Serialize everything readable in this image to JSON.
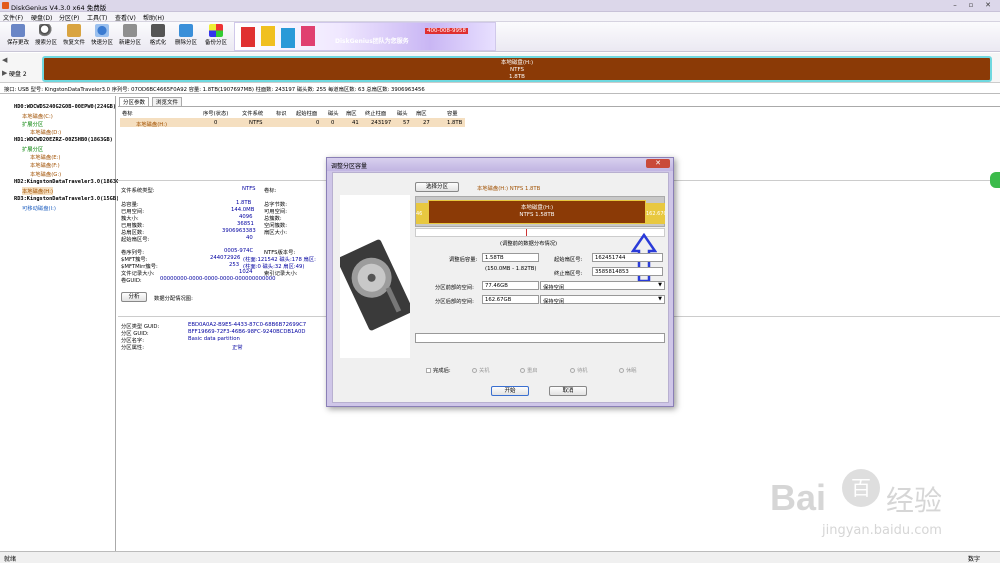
{
  "title": "DiskGenius V4.3.0 x64 免费版",
  "menu": [
    "文件(F)",
    "硬盘(D)",
    "分区(P)",
    "工具(T)",
    "查看(V)",
    "帮助(H)"
  ],
  "toolbar": [
    "保存更改",
    "搜索分区",
    "恢复文件",
    "快速分区",
    "新建分区",
    "格式化",
    "删除分区",
    "备份分区"
  ],
  "banner": {
    "text": "DiskGenius团队为您服务",
    "phone": "400-008-9958"
  },
  "disk_label": "硬盘 2",
  "disk_bar": {
    "name": "本地磁盘(H:)",
    "fs": "NTFS",
    "size": "1.8TB"
  },
  "info": "接口: USB  型号: KingstonDataTraveler3.0  序列号: 07OD6BC4665F0A92  容量: 1.8TB(1907697MB)  柱面数: 243197  磁头数: 255  每道扇区数: 63  总扇区数: 3906963456",
  "tree": [
    {
      "t": "HD0:WDCWDS240G2G0B-00EPW0(224GB)",
      "kind": "hd"
    },
    {
      "t": "本地磁盘(C:)",
      "kind": "p"
    },
    {
      "t": "扩展分区",
      "kind": "ext"
    },
    {
      "t": "本地磁盘(D:)",
      "kind": "p"
    },
    {
      "t": "HD1:WDCWD20EZRZ-00Z5HB0(1863GB)",
      "kind": "hd"
    },
    {
      "t": "扩展分区",
      "kind": "ext"
    },
    {
      "t": "本地磁盘(E:)",
      "kind": "p"
    },
    {
      "t": "本地磁盘(F:)",
      "kind": "p"
    },
    {
      "t": "本地磁盘(G:)",
      "kind": "p"
    },
    {
      "t": "HD2:KingstonDataTraveler3.0(1863GB)",
      "kind": "hd"
    },
    {
      "t": "本地磁盘(H:)",
      "kind": "sel"
    },
    {
      "t": "RD3:KingstonDataTraveler3.0(15GB)",
      "kind": "hd"
    },
    {
      "t": "可移动磁盘(I:)",
      "kind": "rm"
    }
  ],
  "tabs": [
    "分区参数",
    "浏览文件"
  ],
  "table": {
    "headers": [
      "卷标",
      "序号(状态)",
      "文件系统",
      "标识",
      "起始柱面",
      "磁头",
      "扇区",
      "终止柱面",
      "磁头",
      "扇区",
      "容量"
    ],
    "row": [
      "本地磁盘(H:)",
      "0",
      "NTFS",
      "",
      "0",
      "0",
      "41",
      "243197",
      "57",
      "27",
      "1.8TB"
    ]
  },
  "fs": {
    "type_l": "文件系统类型:",
    "type_v": "NTFS",
    "vol_l": "卷标:",
    "left": [
      [
        "总容量:",
        "1.8TB"
      ],
      [
        "已用空间:",
        "144.0MB"
      ],
      [
        "簇大小:",
        "4096"
      ],
      [
        "已用簇数:",
        "36851"
      ],
      [
        "总扇区数:",
        "3906963383"
      ],
      [
        "起始扇区号:",
        "40"
      ]
    ],
    "right": [
      "总字节数:",
      "可用空间:",
      "总簇数:",
      "空闲簇数:",
      "扇区大小:"
    ],
    "mid": [
      [
        "卷序列号:",
        "0005-974C",
        "NTFS版本号:"
      ],
      [
        "$MFT簇号:",
        "244072926",
        "(柱面:121542 磁头:178 扇区:"
      ],
      [
        "$MFTMirr簇号:",
        "253",
        "(柱面:0 磁头:32 扇区:49)"
      ],
      [
        "文件记录大小:",
        "1024",
        "索引记录大小:"
      ],
      [
        "卷GUID:",
        "00000000-0000-0000-0000-000000000000",
        ""
      ]
    ],
    "analyze_btn": "分析",
    "analyze_l": "数据分配情况图:",
    "guid": [
      [
        "分区类型 GUID:",
        "EBD0A0A2-B9E5-4433-87C0-68B6B72699C7"
      ],
      [
        "分区 GUID:",
        "BFF19669-72F3-46B6-98FC-9240BCDB1A0D"
      ],
      [
        "分区名字:",
        "Basic data partition"
      ],
      [
        "分区属性:",
        "正常"
      ]
    ]
  },
  "dialog": {
    "title": "调整分区容量",
    "close": "✕",
    "select_btn": "选择分区",
    "partinfo": "本地磁盘(H:) NTFS 1.8TB",
    "bar": {
      "name": "本地磁盘(H:)",
      "fs": "NTFS 1.58TB",
      "left": "46",
      "right": "162.67G"
    },
    "caption": "(调整前的数据分布情况)",
    "size_l": "调整后容量:",
    "size_v": "1.58TB",
    "range": "(150.0MB - 1.82TB)",
    "start_l": "起始扇区号:",
    "start_v": "162451744",
    "end_l": "终止扇区号:",
    "end_v": "3585814853",
    "before_l": "分区前部的空间:",
    "before_v": "77.46GB",
    "before_opt": "保持空闲",
    "after_l": "分区后部的空间:",
    "after_v": "162.67GB",
    "after_opt": "保持空闲",
    "complete_l": "完成后:",
    "radios": [
      "关机",
      "重启",
      "待机",
      "休眠"
    ],
    "start_btn": "开始",
    "cancel_btn": "取消"
  },
  "status": {
    "left": "就绪",
    "right": "数字"
  },
  "watermark": {
    "brand": "Bai",
    "brand2": "百",
    "text": "经验",
    "url": "jingyan.baidu.com"
  },
  "colors": {
    "partition": "#8b3a06",
    "accent": "#6fd8df",
    "dialog": "#cfc6e8"
  }
}
